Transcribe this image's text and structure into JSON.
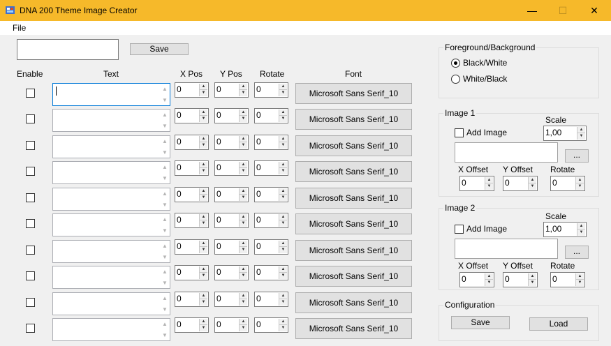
{
  "window": {
    "title": "DNA 200 Theme Image Creator",
    "minimize_glyph": "—",
    "maximize_glyph": "☐",
    "close_glyph": "✕"
  },
  "menu": {
    "file": "File"
  },
  "toolbar": {
    "name_value": "",
    "save_label": "Save"
  },
  "headers": {
    "enable": "Enable",
    "text": "Text",
    "xpos": "X Pos",
    "ypos": "Y Pos",
    "rotate": "Rotate",
    "font": "Font"
  },
  "rows": [
    {
      "enabled": false,
      "text": "",
      "xpos": "0",
      "ypos": "0",
      "rotate": "0",
      "font": "Microsoft Sans Serif_10"
    },
    {
      "enabled": false,
      "text": "",
      "xpos": "0",
      "ypos": "0",
      "rotate": "0",
      "font": "Microsoft Sans Serif_10"
    },
    {
      "enabled": false,
      "text": "",
      "xpos": "0",
      "ypos": "0",
      "rotate": "0",
      "font": "Microsoft Sans Serif_10"
    },
    {
      "enabled": false,
      "text": "",
      "xpos": "0",
      "ypos": "0",
      "rotate": "0",
      "font": "Microsoft Sans Serif_10"
    },
    {
      "enabled": false,
      "text": "",
      "xpos": "0",
      "ypos": "0",
      "rotate": "0",
      "font": "Microsoft Sans Serif_10"
    },
    {
      "enabled": false,
      "text": "",
      "xpos": "0",
      "ypos": "0",
      "rotate": "0",
      "font": "Microsoft Sans Serif_10"
    },
    {
      "enabled": false,
      "text": "",
      "xpos": "0",
      "ypos": "0",
      "rotate": "0",
      "font": "Microsoft Sans Serif_10"
    },
    {
      "enabled": false,
      "text": "",
      "xpos": "0",
      "ypos": "0",
      "rotate": "0",
      "font": "Microsoft Sans Serif_10"
    },
    {
      "enabled": false,
      "text": "",
      "xpos": "0",
      "ypos": "0",
      "rotate": "0",
      "font": "Microsoft Sans Serif_10"
    },
    {
      "enabled": false,
      "text": "",
      "xpos": "0",
      "ypos": "0",
      "rotate": "0",
      "font": "Microsoft Sans Serif_10"
    }
  ],
  "fg_bg": {
    "title": "Foreground/Background",
    "options": [
      {
        "label": "Black/White",
        "selected": true
      },
      {
        "label": "White/Black",
        "selected": false
      }
    ]
  },
  "image1": {
    "title": "Image 1",
    "add_label": "Add Image",
    "add_checked": false,
    "scale_label": "Scale",
    "scale": "1,00",
    "path": "",
    "browse_label": "...",
    "xoffset_label": "X Offset",
    "xoffset": "0",
    "yoffset_label": "Y Offset",
    "yoffset": "0",
    "rotate_label": "Rotate",
    "rotate": "0"
  },
  "image2": {
    "title": "Image 2",
    "add_label": "Add Image",
    "add_checked": false,
    "scale_label": "Scale",
    "scale": "1,00",
    "path": "",
    "browse_label": "...",
    "xoffset_label": "X Offset",
    "xoffset": "0",
    "yoffset_label": "Y Offset",
    "yoffset": "0",
    "rotate_label": "Rotate",
    "rotate": "0"
  },
  "configuration": {
    "title": "Configuration",
    "save_label": "Save",
    "load_label": "Load"
  },
  "spin": {
    "up": "▲",
    "down": "▼"
  },
  "colors": {
    "titlebar": "#f6b92a",
    "focus_border": "#0078d7",
    "window_bg": "#f0f0f0"
  }
}
